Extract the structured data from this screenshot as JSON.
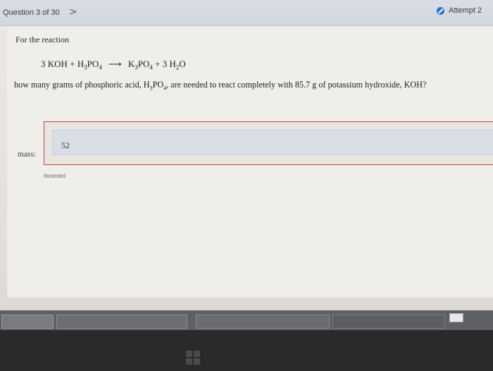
{
  "header": {
    "question_counter": "Question 3 of 30",
    "next_chevron": ">",
    "attempt_label": "Attempt 2"
  },
  "problem": {
    "intro": "For the reaction",
    "equation": {
      "left": "3 KOH + H",
      "left_sub1": "3",
      "left_mid": "PO",
      "left_sub2": "4",
      "arrow": "⟶",
      "right1": "K",
      "right_sub1": "3",
      "right_mid": "PO",
      "right_sub2": "4",
      "right2": " + 3 H",
      "right_sub3": "2",
      "right_end": "O"
    },
    "question_part1": "how many grams of phosphoric acid, H",
    "question_sub1": "3",
    "question_part2": "PO",
    "question_sub2": "4",
    "question_part3": ", are needed to react completely with 85.7 g of potassium hydroxide, KOH?"
  },
  "answer": {
    "label": "mass:",
    "value": "52",
    "feedback": "Incorrect",
    "feedback_color": "#b54a40"
  },
  "colors": {
    "header_bg": "#d6dae3",
    "attempt_icon": "#2e6fd6"
  }
}
